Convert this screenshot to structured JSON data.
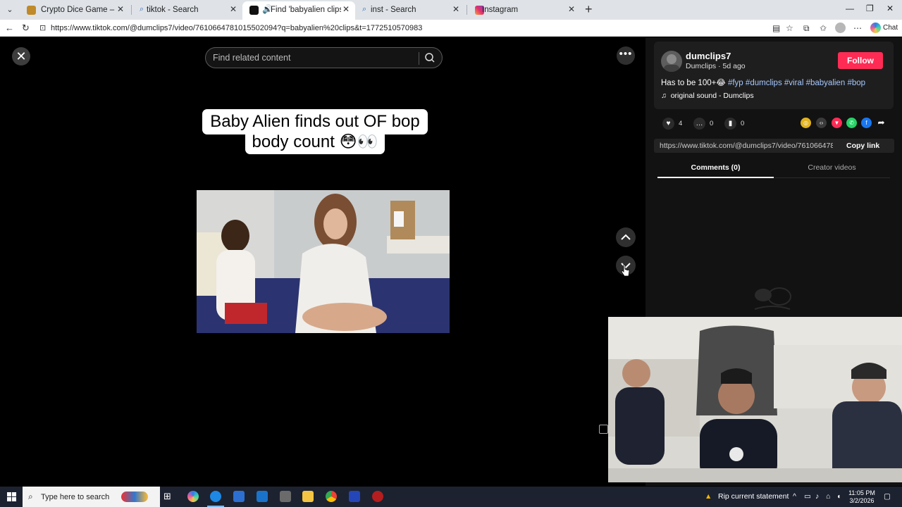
{
  "browser": {
    "tabs": [
      {
        "title": "Crypto Dice Game – Provably Fair",
        "active": false
      },
      {
        "title": "tiktok - Search",
        "active": false
      },
      {
        "title": "Find 'babyalien clips' on TikTo",
        "active": true
      },
      {
        "title": "inst - Search",
        "active": false
      },
      {
        "title": "Instagram",
        "active": false
      }
    ],
    "url": "https://www.tiktok.com/@dumclips7/video/7610664781015502094?q=babyalien%20clips&t=1772510570983",
    "chat_label": "Chat"
  },
  "search": {
    "placeholder": "Find related content"
  },
  "video": {
    "caption_line1": "Baby Alien finds out OF bop",
    "caption_line2": "body count 😳👀"
  },
  "creator": {
    "username": "dumclips7",
    "subline": "Dumclips · 5d ago",
    "follow_label": "Follow",
    "description_prefix": "Has to be 100+😂",
    "hashtags": [
      "#fyp",
      "#dumclips",
      "#viral",
      "#babyalien",
      "#bop"
    ],
    "sound": "original sound - Dumclips"
  },
  "stats": {
    "likes": "4",
    "comments": "0",
    "saves": "0"
  },
  "link": {
    "url": "https://www.tiktok.com/@dumclips7/video/7610664781...",
    "copy_label": "Copy link"
  },
  "panel_tabs": [
    {
      "label": "Comments (0)",
      "active": true
    },
    {
      "label": "Creator videos",
      "active": false
    }
  ],
  "taskbar": {
    "search_placeholder": "Type here to search",
    "notification": "Rip current statement",
    "time": "11:05 PM",
    "date": "3/2/2026"
  },
  "colors": {
    "follow": "#fe2c55",
    "hashtag": "#a6c8ff",
    "panel_bg": "#121212"
  }
}
